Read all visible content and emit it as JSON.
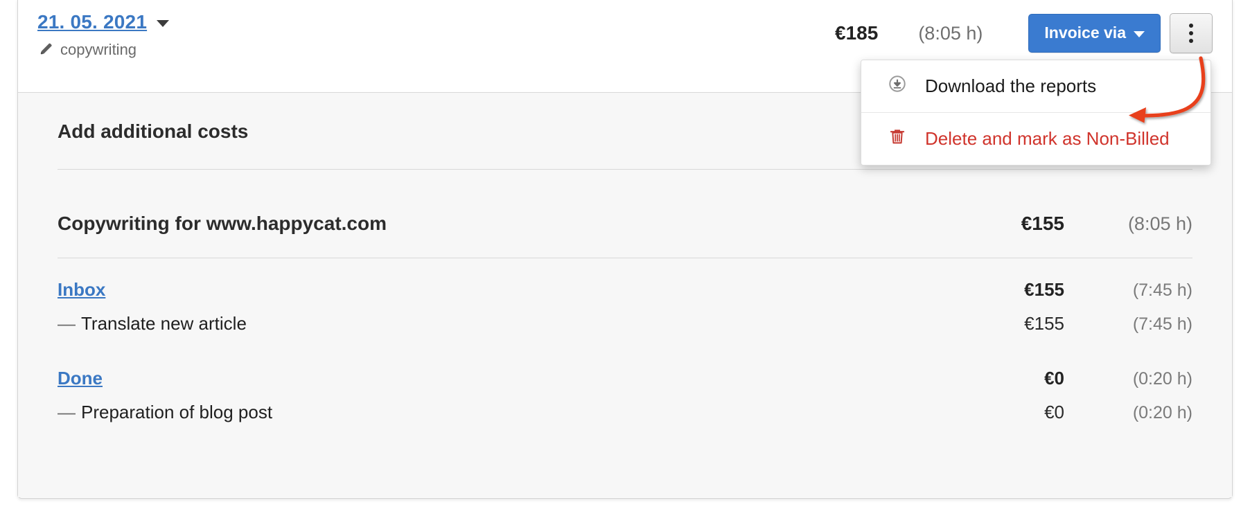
{
  "header": {
    "date_label": "21. 05. 2021",
    "date_caret_icon": "chevron-down-icon",
    "tag_icon": "pencil-icon",
    "tag_label": "copywriting",
    "total_amount": "€185",
    "total_hours": "(8:05 h)",
    "invoice_button_label": "Invoice via",
    "invoice_button_caret_icon": "chevron-down-icon",
    "kebab_button_icon": "kebab-menu-icon"
  },
  "dropdown": {
    "items": [
      {
        "label": "Download the reports",
        "icon": "download-circle-icon",
        "style": "normal"
      },
      {
        "label": "Delete and mark as Non-Billed",
        "icon": "trash-icon",
        "style": "danger"
      }
    ]
  },
  "annotation": {
    "arrow_icon": "curved-arrow-icon",
    "arrow_color": "#e8401f"
  },
  "body": {
    "additional_costs_title": "Add additional costs",
    "project": {
      "name": "Copywriting for www.happycat.com",
      "amount": "€155",
      "hours": "(8:05 h)"
    },
    "groups": [
      {
        "link_label": "Inbox",
        "amount": "€155",
        "hours": "(7:45 h)",
        "entries": [
          {
            "dash": "—",
            "name": "Translate new article",
            "amount": "€155",
            "hours": "(7:45 h)"
          }
        ]
      },
      {
        "link_label": "Done",
        "amount": "€0",
        "hours": "(0:20 h)",
        "entries": [
          {
            "dash": "—",
            "name": "Preparation of blog post",
            "amount": "€0",
            "hours": "(0:20 h)"
          }
        ]
      }
    ]
  },
  "colors": {
    "link_blue": "#3b78c3",
    "primary_button": "#3a7bd0",
    "danger_red": "#d0342c",
    "body_background": "#f7f7f7"
  }
}
